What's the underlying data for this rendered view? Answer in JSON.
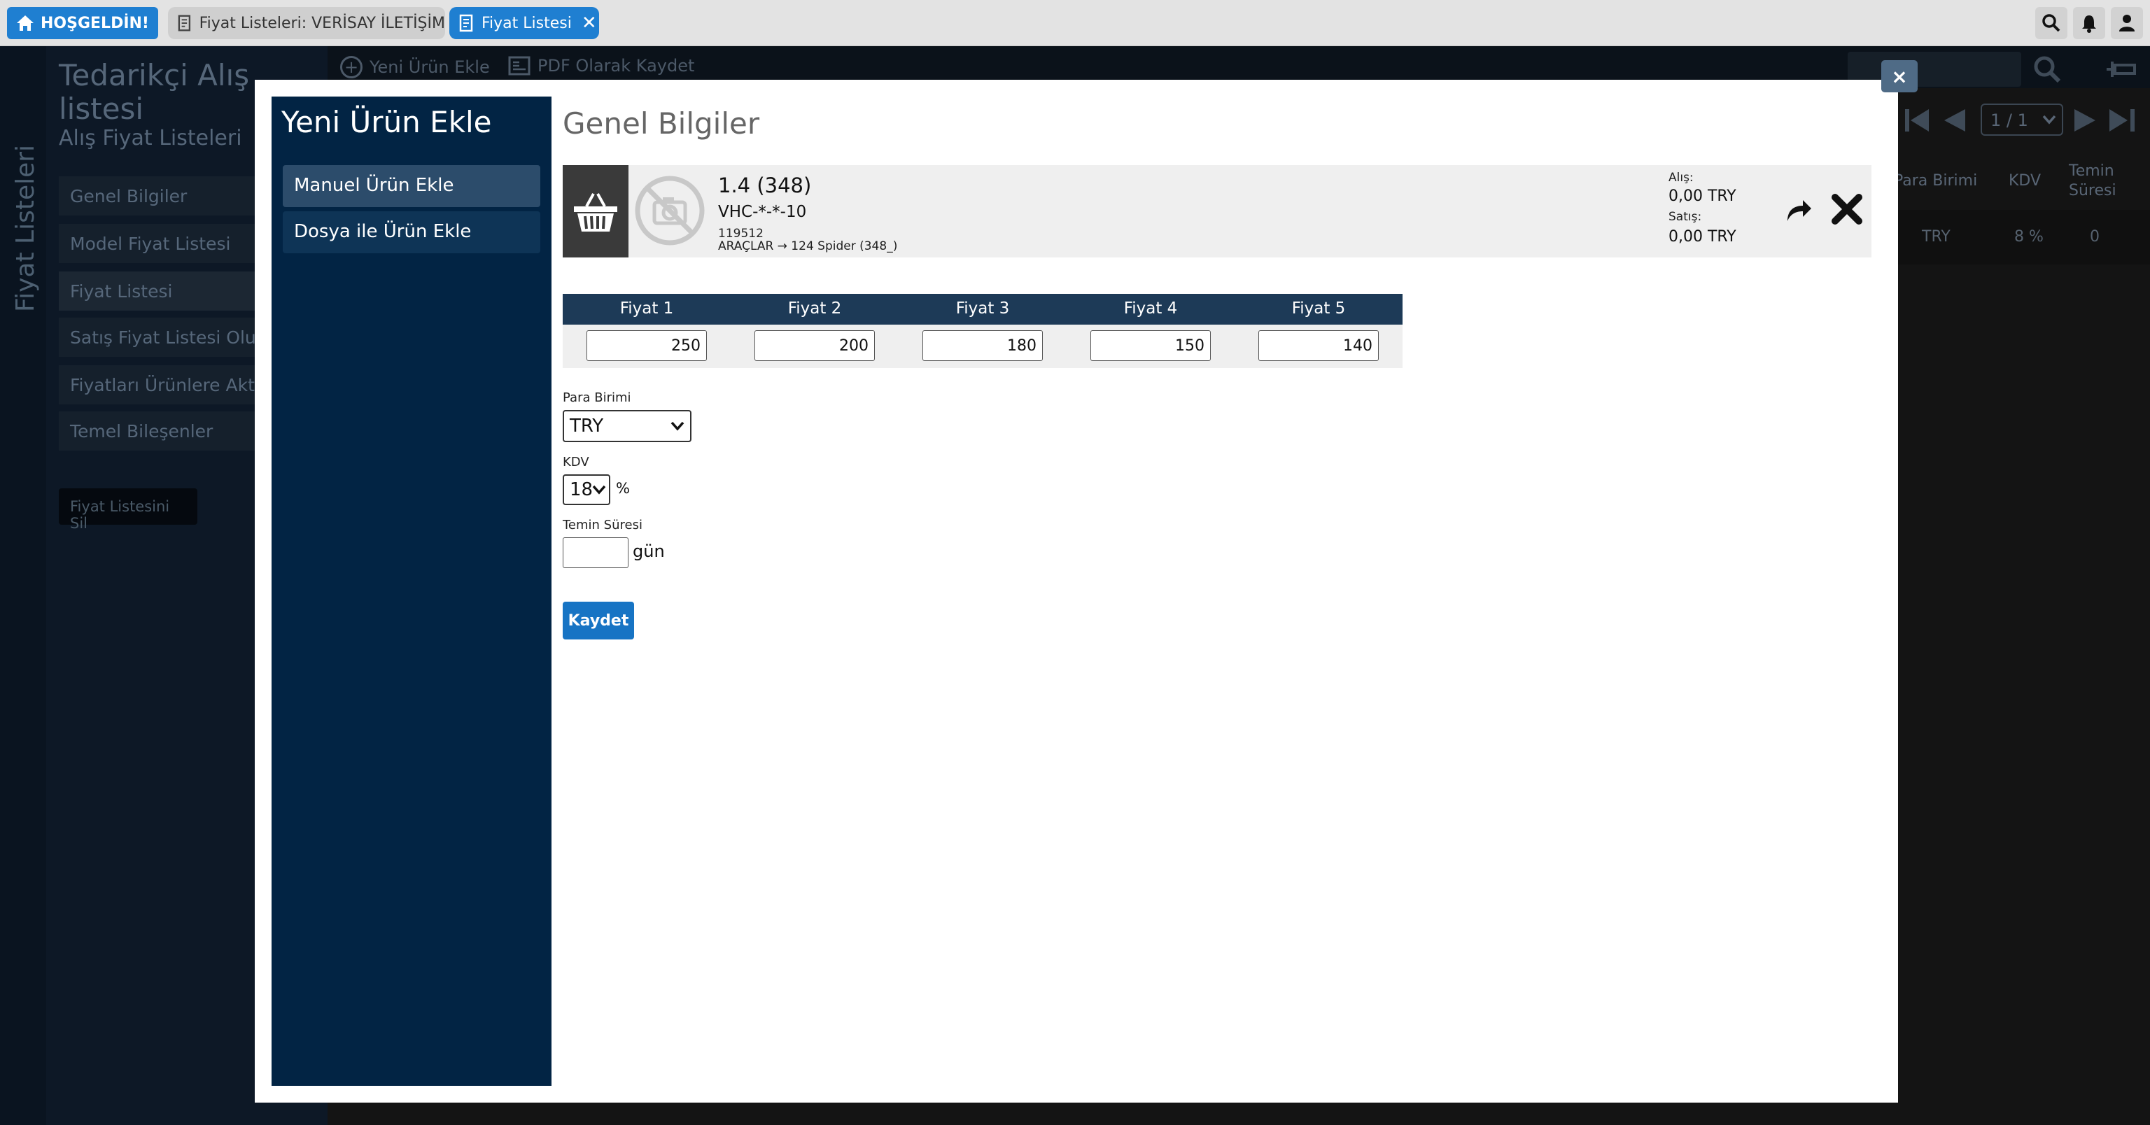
{
  "tabs": {
    "home": "HOŞGELDİN!",
    "list": "Fiyat Listeleri: VERİSAY İLETİŞİM",
    "active": "Fiyat Listesi"
  },
  "background": {
    "vertical_label": "Fiyat Listeleri",
    "title": "Tedarikçi Alış listesi",
    "subtitle": "Alış Fiyat Listeleri",
    "menu": [
      "Genel Bilgiler",
      "Model Fiyat Listesi",
      "Fiyat Listesi",
      "Satış Fiyat Listesi Oluş",
      "Fiyatları Ürünlere Akta",
      "Temel Bileşenler"
    ],
    "delete_button": "Fiyat Listesini Sil",
    "toolbar": {
      "add": "Yeni Ürün Ekle",
      "pdf": "PDF Olarak Kaydet"
    },
    "pager": "1 / 1",
    "columns": {
      "currency": "Para Birimi",
      "vat": "KDV",
      "lead_time_1": "Temin",
      "lead_time_2": "Süresi"
    },
    "row": {
      "currency": "TRY",
      "vat": "8 %",
      "lead_time": "0"
    }
  },
  "modal": {
    "close": "×",
    "side_title": "Yeni Ürün Ekle",
    "side_items": [
      "Manuel Ürün Ekle",
      "Dosya ile Ürün Ekle"
    ],
    "heading": "Genel Bilgiler",
    "product": {
      "name": "1.4 (348)",
      "code": "VHC-*-*-10",
      "id": "119512",
      "path": "ARAÇLAR → 124 Spider (348_)",
      "buy_label": "Alış:",
      "buy_value": "0,00 TRY",
      "sell_label": "Satış:",
      "sell_value": "0,00 TRY"
    },
    "prices": {
      "headers": [
        "Fiyat 1",
        "Fiyat 2",
        "Fiyat 3",
        "Fiyat 4",
        "Fiyat 5"
      ],
      "values": [
        "250",
        "200",
        "180",
        "150",
        "140"
      ]
    },
    "currency": {
      "label": "Para Birimi",
      "value": "TRY"
    },
    "vat": {
      "label": "KDV",
      "value": "18",
      "unit": "%"
    },
    "lead_time": {
      "label": "Temin Süresi",
      "value": "",
      "unit": "gün"
    },
    "save": "Kaydet"
  },
  "colors": {
    "accent": "#1f7fd1",
    "sidebar": "#022444",
    "table_head": "#1d3a57"
  }
}
